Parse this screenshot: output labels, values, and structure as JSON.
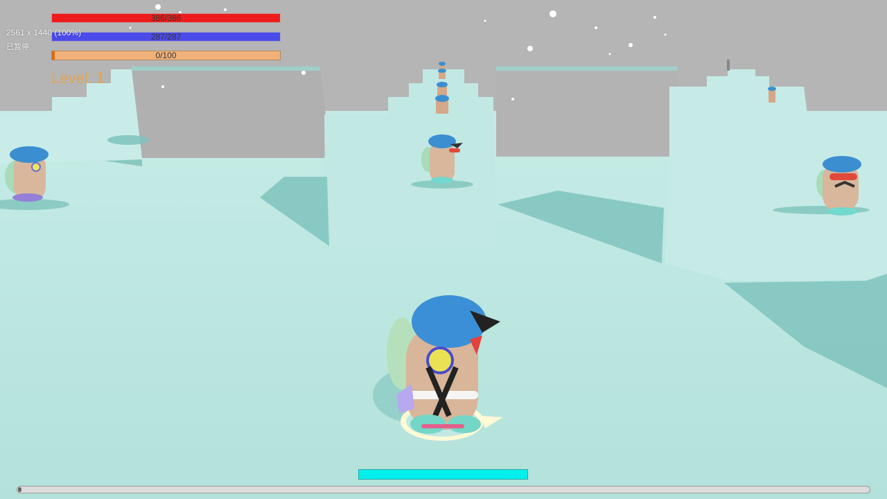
{
  "hud": {
    "health": {
      "label": "386/386",
      "fraction": 1.0,
      "color": "#ee1c1c"
    },
    "mana": {
      "label": "287/287",
      "fraction": 1.0,
      "color": "#4b4bea"
    },
    "exp": {
      "label": "0/100",
      "fraction": 0.0,
      "color": "#f0b27a"
    },
    "level_label": "Level: 1"
  },
  "overlay": {
    "resolution": "2561 x 1440 (100%)",
    "status": "已暂停"
  },
  "cast_bar": {
    "fraction": 1.0,
    "color": "#00f0ee"
  },
  "timeline": {
    "fraction": 0.0
  },
  "icons": {
    "player": "player-character",
    "enemy": "capped-character"
  }
}
